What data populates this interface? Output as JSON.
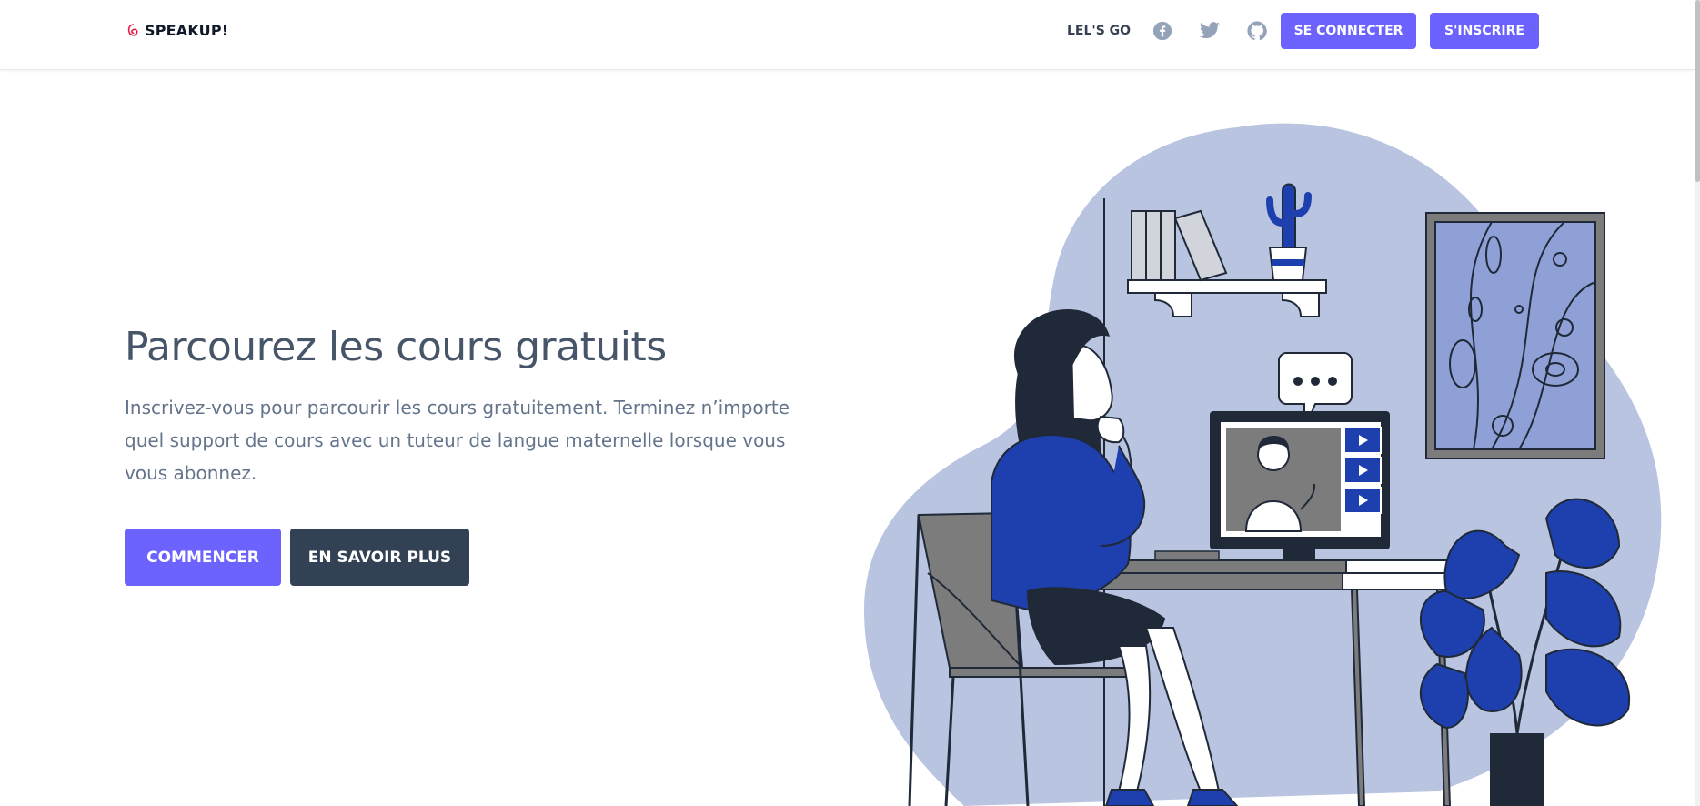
{
  "navbar": {
    "brand": "SPEAKUP!",
    "link": "LEL'S GO",
    "social_icons": [
      "facebook-icon",
      "twitter-icon",
      "github-icon"
    ],
    "login_label": "SE CONNECTER",
    "signup_label": "S'INSCRIRE"
  },
  "hero": {
    "title": "Parcourez les cours gratuits",
    "subtitle": "Inscrivez-vous pour parcourir les cours gratuitement. Terminez n’importe quel support de cours avec un tuteur de langue maternelle lorsque vous vous abonnez.",
    "primary_label": "COMMENCER",
    "secondary_label": "EN SAVOIR PLUS"
  },
  "colors": {
    "accent": "#6c63ff",
    "dark": "#334155",
    "blob": "#b8c4e0",
    "blue": "#1e40af"
  }
}
